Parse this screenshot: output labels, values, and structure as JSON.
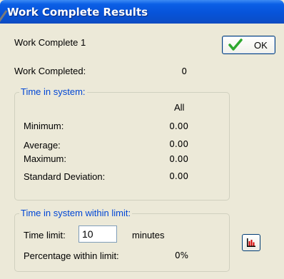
{
  "window": {
    "title": "Work Complete Results"
  },
  "header": {
    "name": "Work Complete 1"
  },
  "buttons": {
    "ok_label": "OK"
  },
  "summary": {
    "work_completed_label": "Work Completed:",
    "work_completed_value": "0"
  },
  "time_in_system": {
    "legend": "Time in system:",
    "column_header": "All",
    "rows": [
      {
        "label": "Minimum:",
        "value": "0.00"
      },
      {
        "label": "Average:",
        "value": "0.00"
      },
      {
        "label": "Maximum:",
        "value": "0.00"
      },
      {
        "label": "Standard Deviation:",
        "value": "0.00"
      }
    ]
  },
  "time_limit": {
    "legend": "Time in system within limit:",
    "limit_label": "Time limit:",
    "limit_value": "10",
    "unit": "minutes",
    "percentage_label": "Percentage within limit:",
    "percentage_value": "0%"
  },
  "icons": {
    "ok": "checkmark-icon",
    "chart": "bar-chart-icon"
  },
  "colors": {
    "title_bar": "#0753d9",
    "legend_text": "#0046d5",
    "window_bg": "#ece9d8",
    "check": "#2ea82e",
    "chart": "#d40000"
  }
}
